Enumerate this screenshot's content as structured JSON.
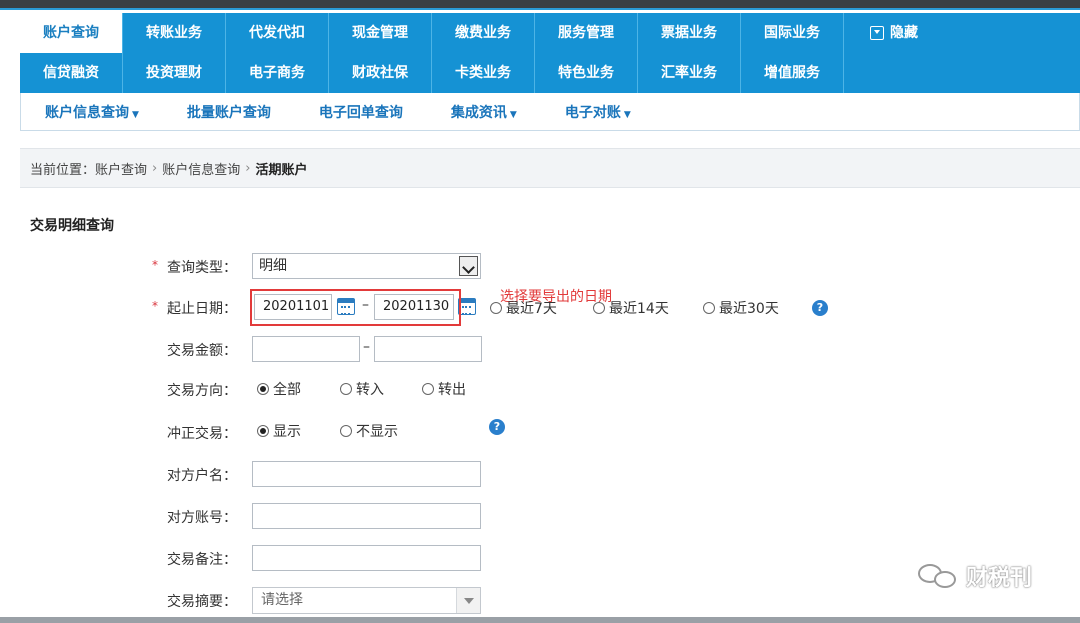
{
  "nav": {
    "row1": [
      "账户查询",
      "转账业务",
      "代发代扣",
      "现金管理",
      "缴费业务",
      "服务管理",
      "票据业务",
      "国际业务"
    ],
    "hide_label": "隐藏",
    "row2": [
      "信贷融资",
      "投资理财",
      "电子商务",
      "财政社保",
      "卡类业务",
      "特色业务",
      "汇率业务",
      "增值服务"
    ],
    "active": "账户查询"
  },
  "subnav": {
    "items": [
      "账户信息查询",
      "批量账户查询",
      "电子回单查询",
      "集成资讯",
      "电子对账"
    ]
  },
  "breadcrumb": {
    "prefix": "当前位置：",
    "items": [
      "账户查询",
      "账户信息查询"
    ],
    "current": "活期账户"
  },
  "form": {
    "title": "交易明细查询",
    "query_type": {
      "label": "查询类型：",
      "value": "明细"
    },
    "date_range": {
      "label": "起止日期：",
      "start": "20201101",
      "end": "20201130",
      "quick": [
        "最近7天",
        "最近14天",
        "最近30天"
      ]
    },
    "amount": {
      "label": "交易金额："
    },
    "direction": {
      "label": "交易方向：",
      "options": [
        "全部",
        "转入",
        "转出"
      ],
      "selected": "全部"
    },
    "reversal": {
      "label": "冲正交易：",
      "options": [
        "显示",
        "不显示"
      ],
      "selected": "显示"
    },
    "counterparty_name": {
      "label": "对方户名："
    },
    "counterparty_account": {
      "label": "对方账号："
    },
    "remark": {
      "label": "交易备注："
    },
    "summary": {
      "label": "交易摘要：",
      "placeholder": "请选择"
    },
    "dash": "–"
  },
  "annotation": "选择要导出的日期",
  "help_icon": "?",
  "watermark": "财税刊"
}
